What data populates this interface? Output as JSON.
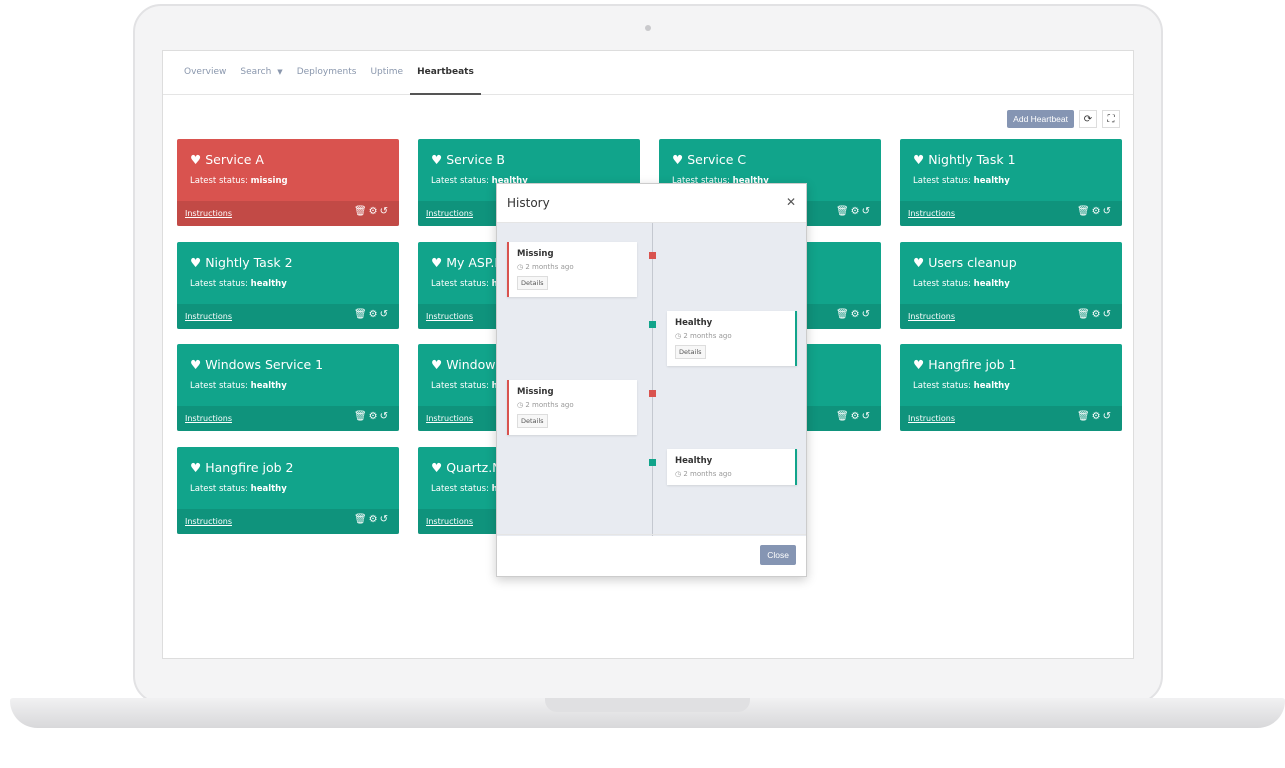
{
  "nav": {
    "tabs": [
      "Overview",
      "Search",
      "Deployments",
      "Uptime",
      "Heartbeats"
    ],
    "active": "Heartbeats"
  },
  "toolbar": {
    "add_label": "Add Heartbeat",
    "refresh_icon": "refresh-icon",
    "fullscreen_icon": "fullscreen-icon"
  },
  "common": {
    "status_prefix": "Latest status:",
    "instructions": "Instructions"
  },
  "cards": [
    {
      "name": "Service A",
      "status": "missing"
    },
    {
      "name": "Service B",
      "status": "healthy"
    },
    {
      "name": "Service C",
      "status": "healthy"
    },
    {
      "name": "Nightly Task 1",
      "status": "healthy"
    },
    {
      "name": "Nightly Task 2",
      "status": "healthy"
    },
    {
      "name": "My ASP.N",
      "status": "he"
    },
    {
      "name": "",
      "status": ""
    },
    {
      "name": "Users cleanup",
      "status": "healthy"
    },
    {
      "name": "Windows Service 1",
      "status": "healthy"
    },
    {
      "name": "Windows",
      "status": "he"
    },
    {
      "name": "",
      "status": ""
    },
    {
      "name": "Hangfire job 1",
      "status": "healthy"
    },
    {
      "name": "Hangfire job 2",
      "status": "healthy"
    },
    {
      "name": "Quartz.N",
      "status": "he"
    }
  ],
  "colors": {
    "healthy": "#11a48b",
    "missing": "#d9534f",
    "button": "#8595b3"
  },
  "modal": {
    "title": "History",
    "close_label": "Close",
    "events": [
      {
        "status": "Missing",
        "time": "2 months ago",
        "details": "Details"
      },
      {
        "status": "Healthy",
        "time": "2 months ago",
        "details": "Details"
      },
      {
        "status": "Missing",
        "time": "2 months ago",
        "details": "Details"
      },
      {
        "status": "Healthy",
        "time": "2 months ago"
      }
    ]
  }
}
